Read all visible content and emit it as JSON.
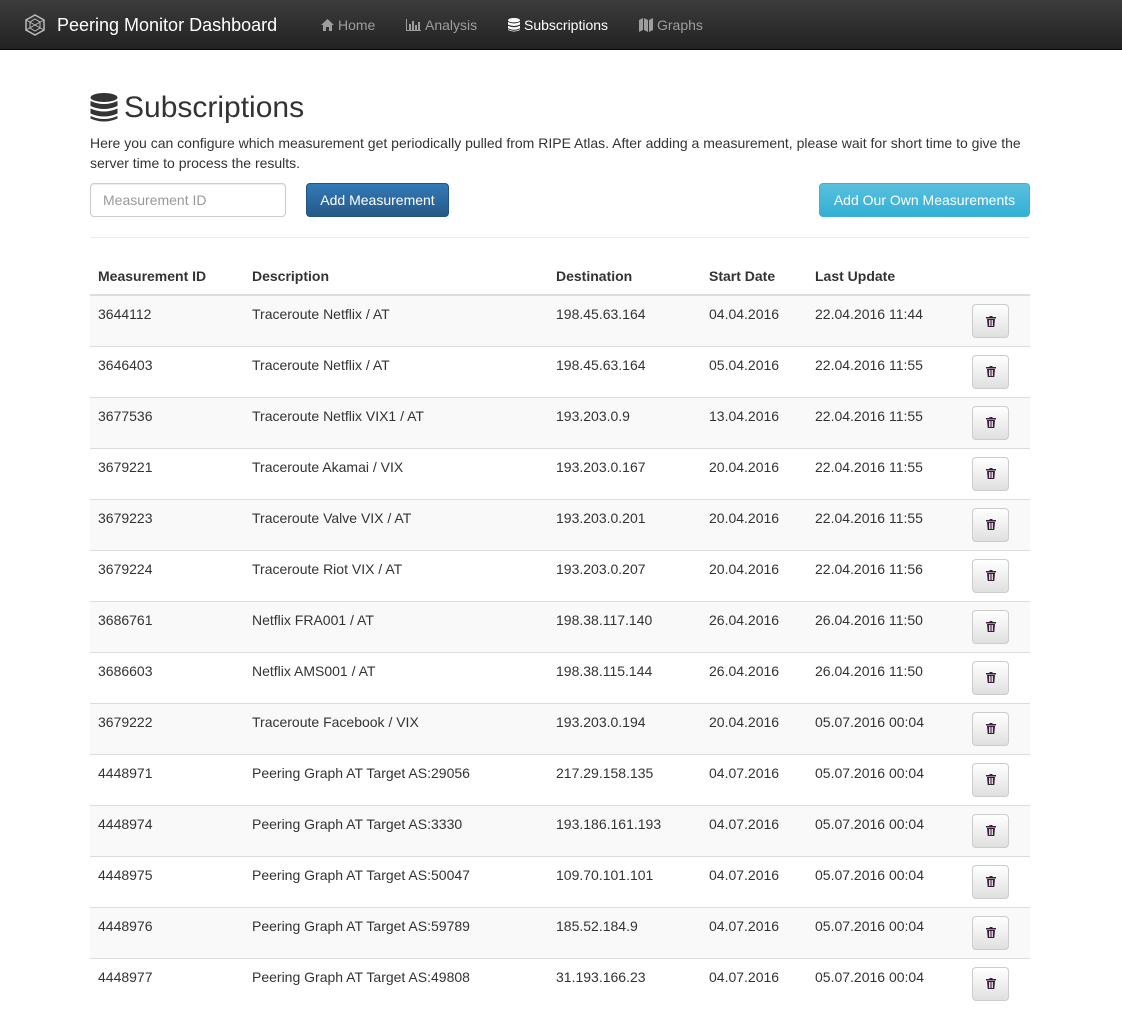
{
  "navbar": {
    "brand": "Peering Monitor Dashboard",
    "items": [
      {
        "label": "Home",
        "icon": "home-icon",
        "active": false
      },
      {
        "label": "Analysis",
        "icon": "stats-icon",
        "active": false
      },
      {
        "label": "Subscriptions",
        "icon": "database-icon",
        "active": true
      },
      {
        "label": "Graphs",
        "icon": "map-icon",
        "active": false
      }
    ]
  },
  "page": {
    "title": "Subscriptions",
    "intro": "Here you can configure which measurement get periodically pulled from RIPE Atlas. After adding a measurement, please wait for short time to give the server time to process the results.",
    "input_placeholder": "Measurement ID",
    "add_button": "Add Measurement",
    "own_button": "Add Our Own Measurements"
  },
  "table": {
    "headers": [
      "Measurement ID",
      "Description",
      "Destination",
      "Start Date",
      "Last Update",
      ""
    ],
    "rows": [
      {
        "id": "3644112",
        "description": "Traceroute Netflix / AT",
        "destination": "198.45.63.164",
        "start": "04.04.2016",
        "update": "22.04.2016 11:44"
      },
      {
        "id": "3646403",
        "description": "Traceroute Netflix / AT",
        "destination": "198.45.63.164",
        "start": "05.04.2016",
        "update": "22.04.2016 11:55"
      },
      {
        "id": "3677536",
        "description": "Traceroute Netflix VIX1 / AT",
        "destination": "193.203.0.9",
        "start": "13.04.2016",
        "update": "22.04.2016 11:55"
      },
      {
        "id": "3679221",
        "description": "Traceroute Akamai / VIX",
        "destination": "193.203.0.167",
        "start": "20.04.2016",
        "update": "22.04.2016 11:55"
      },
      {
        "id": "3679223",
        "description": "Traceroute Valve VIX / AT",
        "destination": "193.203.0.201",
        "start": "20.04.2016",
        "update": "22.04.2016 11:55"
      },
      {
        "id": "3679224",
        "description": "Traceroute Riot VIX / AT",
        "destination": "193.203.0.207",
        "start": "20.04.2016",
        "update": "22.04.2016 11:56"
      },
      {
        "id": "3686761",
        "description": "Netflix FRA001 / AT",
        "destination": "198.38.117.140",
        "start": "26.04.2016",
        "update": "26.04.2016 11:50"
      },
      {
        "id": "3686603",
        "description": "Netflix AMS001 / AT",
        "destination": "198.38.115.144",
        "start": "26.04.2016",
        "update": "26.04.2016 11:50"
      },
      {
        "id": "3679222",
        "description": "Traceroute Facebook / VIX",
        "destination": "193.203.0.194",
        "start": "20.04.2016",
        "update": "05.07.2016 00:04"
      },
      {
        "id": "4448971",
        "description": "Peering Graph AT Target AS:29056",
        "destination": "217.29.158.135",
        "start": "04.07.2016",
        "update": "05.07.2016 00:04"
      },
      {
        "id": "4448974",
        "description": "Peering Graph AT Target AS:3330",
        "destination": "193.186.161.193",
        "start": "04.07.2016",
        "update": "05.07.2016 00:04"
      },
      {
        "id": "4448975",
        "description": "Peering Graph AT Target AS:50047",
        "destination": "109.70.101.101",
        "start": "04.07.2016",
        "update": "05.07.2016 00:04"
      },
      {
        "id": "4448976",
        "description": "Peering Graph AT Target AS:59789",
        "destination": "185.52.184.9",
        "start": "04.07.2016",
        "update": "05.07.2016 00:04"
      },
      {
        "id": "4448977",
        "description": "Peering Graph AT Target AS:49808",
        "destination": "31.193.166.23",
        "start": "04.07.2016",
        "update": "05.07.2016 00:04"
      }
    ]
  },
  "colors": {
    "navbar_bg": "#222222",
    "nav_text": "#9d9d9d",
    "primary": "#337ab7",
    "info": "#5bc0de",
    "trash_icon": "#3a1f3a"
  }
}
